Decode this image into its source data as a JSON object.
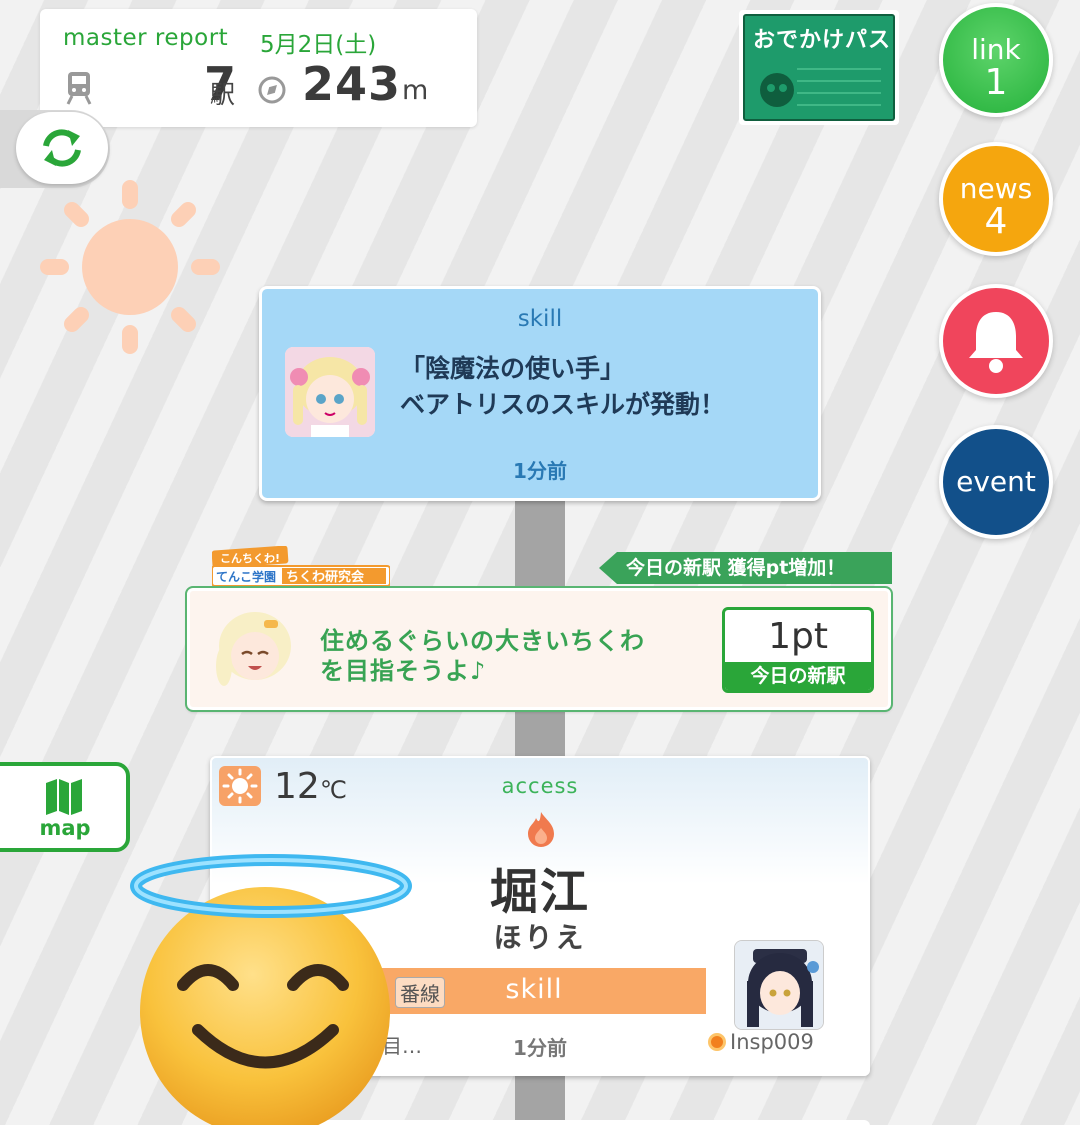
{
  "report": {
    "title": "master report",
    "date": "5月2日(土)",
    "stations": "7",
    "stations_unit": "駅",
    "distance": "243",
    "distance_unit": "m"
  },
  "pass": {
    "label": "おでかけパス"
  },
  "buttons": {
    "link": {
      "label": "link",
      "count": "1"
    },
    "news": {
      "label": "news",
      "count": "4"
    },
    "event": {
      "label": "event"
    }
  },
  "skill_card": {
    "header": "skill",
    "line1": "「陰魔法の使い手」",
    "line2": "ベアトリスのスキルが発動！",
    "time": "1分前"
  },
  "banner": {
    "text": "今日の新駅 獲得pt増加！"
  },
  "chikuwa_card": {
    "line1": "住めるぐらいの大きいちくわ",
    "line2": "を目指そうよ♪",
    "points": "1pt",
    "points_label": "今日の新駅"
  },
  "map_tab": {
    "label": "map"
  },
  "station_card": {
    "temperature": "12",
    "temp_unit": "℃",
    "header": "access",
    "name": "堀江",
    "kana": "ほりえ",
    "line_label": "番線",
    "bar_label": "skill",
    "left_text": "目…",
    "time": "1分前",
    "user": "Insp009"
  },
  "colors": {
    "green": "#2aa639",
    "skill_blue": "#a5d8f7",
    "orange": "#f9a866",
    "news": "#f5a60e",
    "bell": "#f0455c",
    "event": "#12508a"
  },
  "icons": [
    "train-icon",
    "compass-icon",
    "refresh-icon",
    "sun-icon",
    "bell-icon",
    "map-icon",
    "fire-icon",
    "smiling-halo-emoji"
  ]
}
